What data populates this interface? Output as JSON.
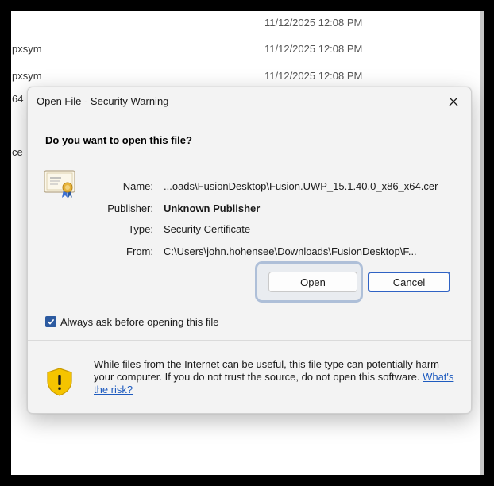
{
  "background": {
    "rows": [
      {
        "name": "",
        "date": "11/12/2025 12:08 PM"
      },
      {
        "name": "pxsym",
        "date": "11/12/2025 12:08 PM"
      },
      {
        "name": "pxsym",
        "date": "11/12/2025 12:08 PM"
      }
    ],
    "fragments": [
      "64",
      "ce"
    ]
  },
  "dialog": {
    "title": "Open File - Security Warning",
    "question": "Do you want to open this file?",
    "fields": {
      "name_label": "Name:",
      "name_value": "...oads\\FusionDesktop\\Fusion.UWP_15.1.40.0_x86_x64.cer",
      "publisher_label": "Publisher:",
      "publisher_value": "Unknown Publisher",
      "type_label": "Type:",
      "type_value": "Security Certificate",
      "from_label": "From:",
      "from_value": "C:\\Users\\john.hohensee\\Downloads\\FusionDesktop\\F..."
    },
    "buttons": {
      "open": "Open",
      "cancel": "Cancel"
    },
    "checkbox": {
      "label": "Always ask before opening this file",
      "checked": true
    },
    "warning": {
      "text": "While files from the Internet can be useful, this file type can potentially harm your computer. If you do not trust the source, do not open this software.",
      "link": "What's the risk?"
    }
  },
  "icons": [
    "certificate-icon",
    "close-icon",
    "checkmark-icon",
    "warning-shield-icon"
  ],
  "colors": {
    "accent": "#2f62c4",
    "checkbox": "#2c5aa0",
    "link": "#1e5bbf",
    "shield": "#f5c400",
    "highlight": "#aebfd8"
  }
}
